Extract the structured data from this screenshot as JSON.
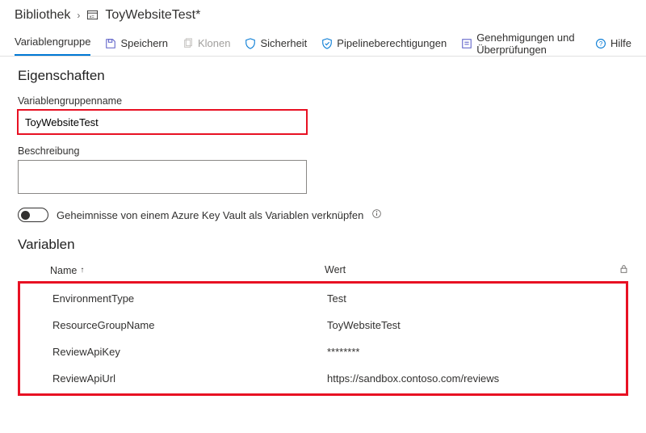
{
  "breadcrumb": {
    "library": "Bibliothek",
    "title": "ToyWebsiteTest*"
  },
  "toolbar": {
    "tab_variable_group": "Variablengruppe",
    "save": "Speichern",
    "clone": "Klonen",
    "security": "Sicherheit",
    "pipeline_permissions": "Pipelineberechtigungen",
    "approvals_checks": "Genehmigungen und Überprüfungen",
    "help": "Hilfe"
  },
  "properties": {
    "section_title": "Eigenschaften",
    "name_label": "Variablengruppenname",
    "name_value": "ToyWebsiteTest",
    "description_label": "Beschreibung",
    "description_value": "",
    "keyvault_toggle_label": "Geheimnisse von einem Azure Key Vault als Variablen verknüpfen"
  },
  "variables": {
    "section_title": "Variablen",
    "header_name": "Name",
    "header_value": "Wert",
    "rows": [
      {
        "name": "EnvironmentType",
        "value": "Test"
      },
      {
        "name": "ResourceGroupName",
        "value": "ToyWebsiteTest"
      },
      {
        "name": "ReviewApiKey",
        "value": "********"
      },
      {
        "name": "ReviewApiUrl",
        "value": "https://sandbox.contoso.com/reviews"
      }
    ]
  }
}
